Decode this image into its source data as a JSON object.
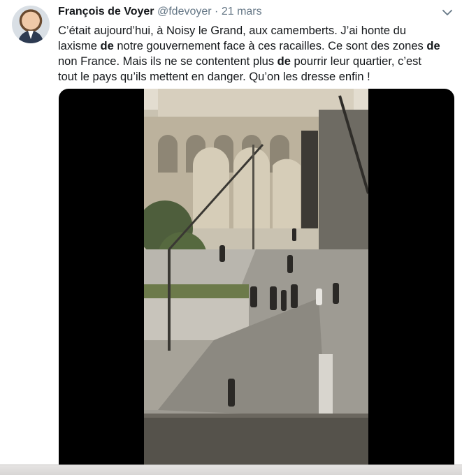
{
  "tweet": {
    "author_name": "François de Voyer",
    "author_handle": "@fdevoyer",
    "separator": "·",
    "date": "21 mars",
    "lines": [
      [
        {
          "t": "C’était aujourd’hui, à Noisy le Grand, aux camemberts. J’ai honte du",
          "b": false
        }
      ],
      [
        {
          "t": "laxisme ",
          "b": false
        },
        {
          "t": "de",
          "b": true
        },
        {
          "t": " notre gouvernement face à ces racailles. Ce sont des zones ",
          "b": false
        },
        {
          "t": "de",
          "b": true
        }
      ],
      [
        {
          "t": " non France. Mais ils ne se contentent plus ",
          "b": false
        },
        {
          "t": "de",
          "b": true
        },
        {
          "t": " pourrir leur quartier, c’est",
          "b": false
        }
      ],
      [
        {
          "t": "tout le pays qu’ils mettent en danger. Qu’on les dresse enfin !",
          "b": false
        }
      ]
    ]
  },
  "icons": {
    "menu": "chevron-down-icon",
    "avatar": "profile-photo"
  },
  "colors": {
    "text": "#14171a",
    "secondary": "#657786",
    "media_background": "#000000"
  }
}
